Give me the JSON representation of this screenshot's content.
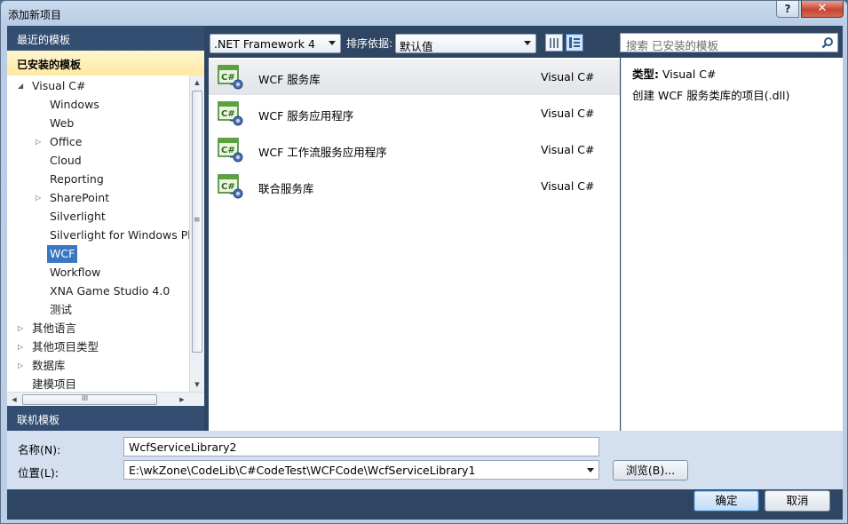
{
  "window": {
    "title": "添加新项目",
    "help_label": "?",
    "close_label": "✕"
  },
  "left": {
    "recent_header": "最近的模板",
    "installed_header": "已安装的模板",
    "online_header": "联机模板",
    "tree": [
      {
        "label": "Visual C#",
        "expander": "◢",
        "level": 0
      },
      {
        "label": "Windows",
        "expander": "",
        "level": 1
      },
      {
        "label": "Web",
        "expander": "",
        "level": 1
      },
      {
        "label": "Office",
        "expander": "▷",
        "level": 1
      },
      {
        "label": "Cloud",
        "expander": "",
        "level": 1
      },
      {
        "label": "Reporting",
        "expander": "",
        "level": 1
      },
      {
        "label": "SharePoint",
        "expander": "▷",
        "level": 1
      },
      {
        "label": "Silverlight",
        "expander": "",
        "level": 1
      },
      {
        "label": "Silverlight for Windows Phc",
        "expander": "",
        "level": 1
      },
      {
        "label": "WCF",
        "expander": "",
        "level": 1,
        "selected": true
      },
      {
        "label": "Workflow",
        "expander": "",
        "level": 1
      },
      {
        "label": "XNA Game Studio 4.0",
        "expander": "",
        "level": 1
      },
      {
        "label": "测试",
        "expander": "",
        "level": 1
      },
      {
        "label": "其他语言",
        "expander": "▷",
        "level": 0
      },
      {
        "label": "其他项目类型",
        "expander": "▷",
        "level": 0
      },
      {
        "label": "数据库",
        "expander": "▷",
        "level": 0
      },
      {
        "label": "建模项目",
        "expander": "",
        "level": 0
      }
    ],
    "scroll_grip": "≡",
    "hscroll_grip": "III"
  },
  "toolbar": {
    "framework": ".NET Framework 4",
    "sort_label": "排序依据:",
    "sort_value": "默认值",
    "search_placeholder": "搜索 已安装的模板"
  },
  "templates": [
    {
      "name": "WCF 服务库",
      "lang": "Visual C#",
      "selected": true
    },
    {
      "name": "WCF 服务应用程序",
      "lang": "Visual C#"
    },
    {
      "name": "WCF 工作流服务应用程序",
      "lang": "Visual C#"
    },
    {
      "name": "联合服务库",
      "lang": "Visual C#"
    }
  ],
  "detail": {
    "type_label": "类型:",
    "type_value": "Visual C#",
    "description": "创建 WCF 服务类库的项目(.dll)"
  },
  "form": {
    "name_label": "名称(N):",
    "name_value": "WcfServiceLibrary2",
    "location_label": "位置(L):",
    "location_value": "E:\\wkZone\\CodeLib\\C#CodeTest\\WCFCode\\WcfServiceLibrary1",
    "browse_label": "浏览(B)..."
  },
  "buttons": {
    "ok": "确定",
    "cancel": "取消"
  },
  "colors": {
    "accent": "#3a78c3",
    "panel": "#2e4664",
    "installed_header": "#ffe9a3"
  }
}
